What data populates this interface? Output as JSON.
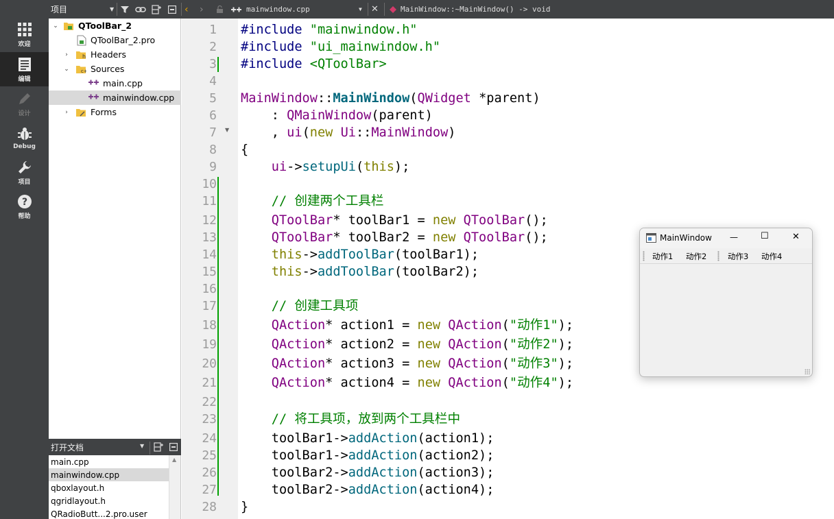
{
  "modebar": {
    "items": [
      {
        "label": "欢迎",
        "icon": "grid-icon"
      },
      {
        "label": "编辑",
        "icon": "edit-document-icon"
      },
      {
        "label": "设计",
        "icon": "pen-icon"
      },
      {
        "label": "Debug",
        "icon": "bug-icon"
      },
      {
        "label": "项目",
        "icon": "wrench-icon"
      },
      {
        "label": "帮助",
        "icon": "help-icon"
      }
    ]
  },
  "topbar": {
    "panel_title": "项目",
    "file_name": "mainwindow.cpp",
    "symbol": "MainWindow::~MainWindow() -> void"
  },
  "tree": {
    "items": [
      {
        "label": "QToolBar_2"
      },
      {
        "label": "QToolBar_2.pro"
      },
      {
        "label": "Headers"
      },
      {
        "label": "Sources"
      },
      {
        "label": "main.cpp"
      },
      {
        "label": "mainwindow.cpp"
      },
      {
        "label": "Forms"
      }
    ]
  },
  "opendocs": {
    "title": "打开文档",
    "items": [
      "main.cpp",
      "mainwindow.cpp",
      "qboxlayout.h",
      "qgridlayout.h",
      "QRadioButt...2.pro.user"
    ]
  },
  "editor": {
    "line_numbers": [
      "1",
      "2",
      "3",
      "4",
      "5",
      "6",
      "7",
      "8",
      "9",
      "10",
      "11",
      "12",
      "13",
      "14",
      "15",
      "16",
      "17",
      "18",
      "19",
      "20",
      "21",
      "22",
      "23",
      "24",
      "25",
      "26",
      "27",
      "28"
    ]
  },
  "mainwindow": {
    "title": "MainWindow",
    "actions": [
      "动作1",
      "动作2",
      "动作3",
      "动作4"
    ],
    "minimize": "—",
    "maximize": "☐",
    "close": "✕"
  },
  "colors": {
    "modebar_bg": "#404244",
    "keyword": "#808000",
    "class": "#800080",
    "function": "#00677c",
    "string": "#008000",
    "preprocessor": "#000080",
    "change_marker": "#00a000"
  }
}
